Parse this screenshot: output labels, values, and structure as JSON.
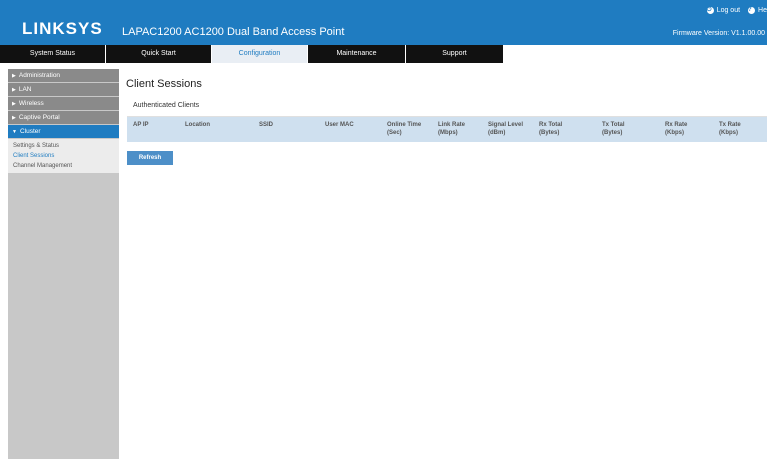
{
  "header": {
    "logo": "LINKSYS",
    "product": "LAPAC1200 AC1200 Dual Band Access Point",
    "logout": "Log out",
    "help": "He",
    "firmware": "Firmware Version: V1.1.00.00"
  },
  "nav": {
    "tabs": [
      "System Status",
      "Quick Start",
      "Configuration",
      "Maintenance",
      "Support"
    ]
  },
  "sidebar": {
    "items": [
      {
        "label": "Administration"
      },
      {
        "label": "LAN"
      },
      {
        "label": "Wireless"
      },
      {
        "label": "Captive Portal"
      },
      {
        "label": "Cluster"
      }
    ],
    "subitems": [
      "Settings & Status",
      "Client Sessions",
      "Channel Management"
    ]
  },
  "main": {
    "title": "Client Sessions",
    "section": "Authenticated Clients",
    "columns": [
      [
        "AP IP",
        ""
      ],
      [
        "Location",
        ""
      ],
      [
        "SSID",
        ""
      ],
      [
        "User MAC",
        ""
      ],
      [
        "Online Time",
        "(Sec)"
      ],
      [
        "Link Rate",
        "(Mbps)"
      ],
      [
        "Signal Level",
        "(dBm)"
      ],
      [
        "Rx Total",
        "(Bytes)"
      ],
      [
        "Tx Total",
        "(Bytes)"
      ],
      [
        "Rx Rate",
        "(Kbps)"
      ],
      [
        "Tx Rate",
        "(Kbps)"
      ]
    ],
    "refresh": "Refresh"
  }
}
